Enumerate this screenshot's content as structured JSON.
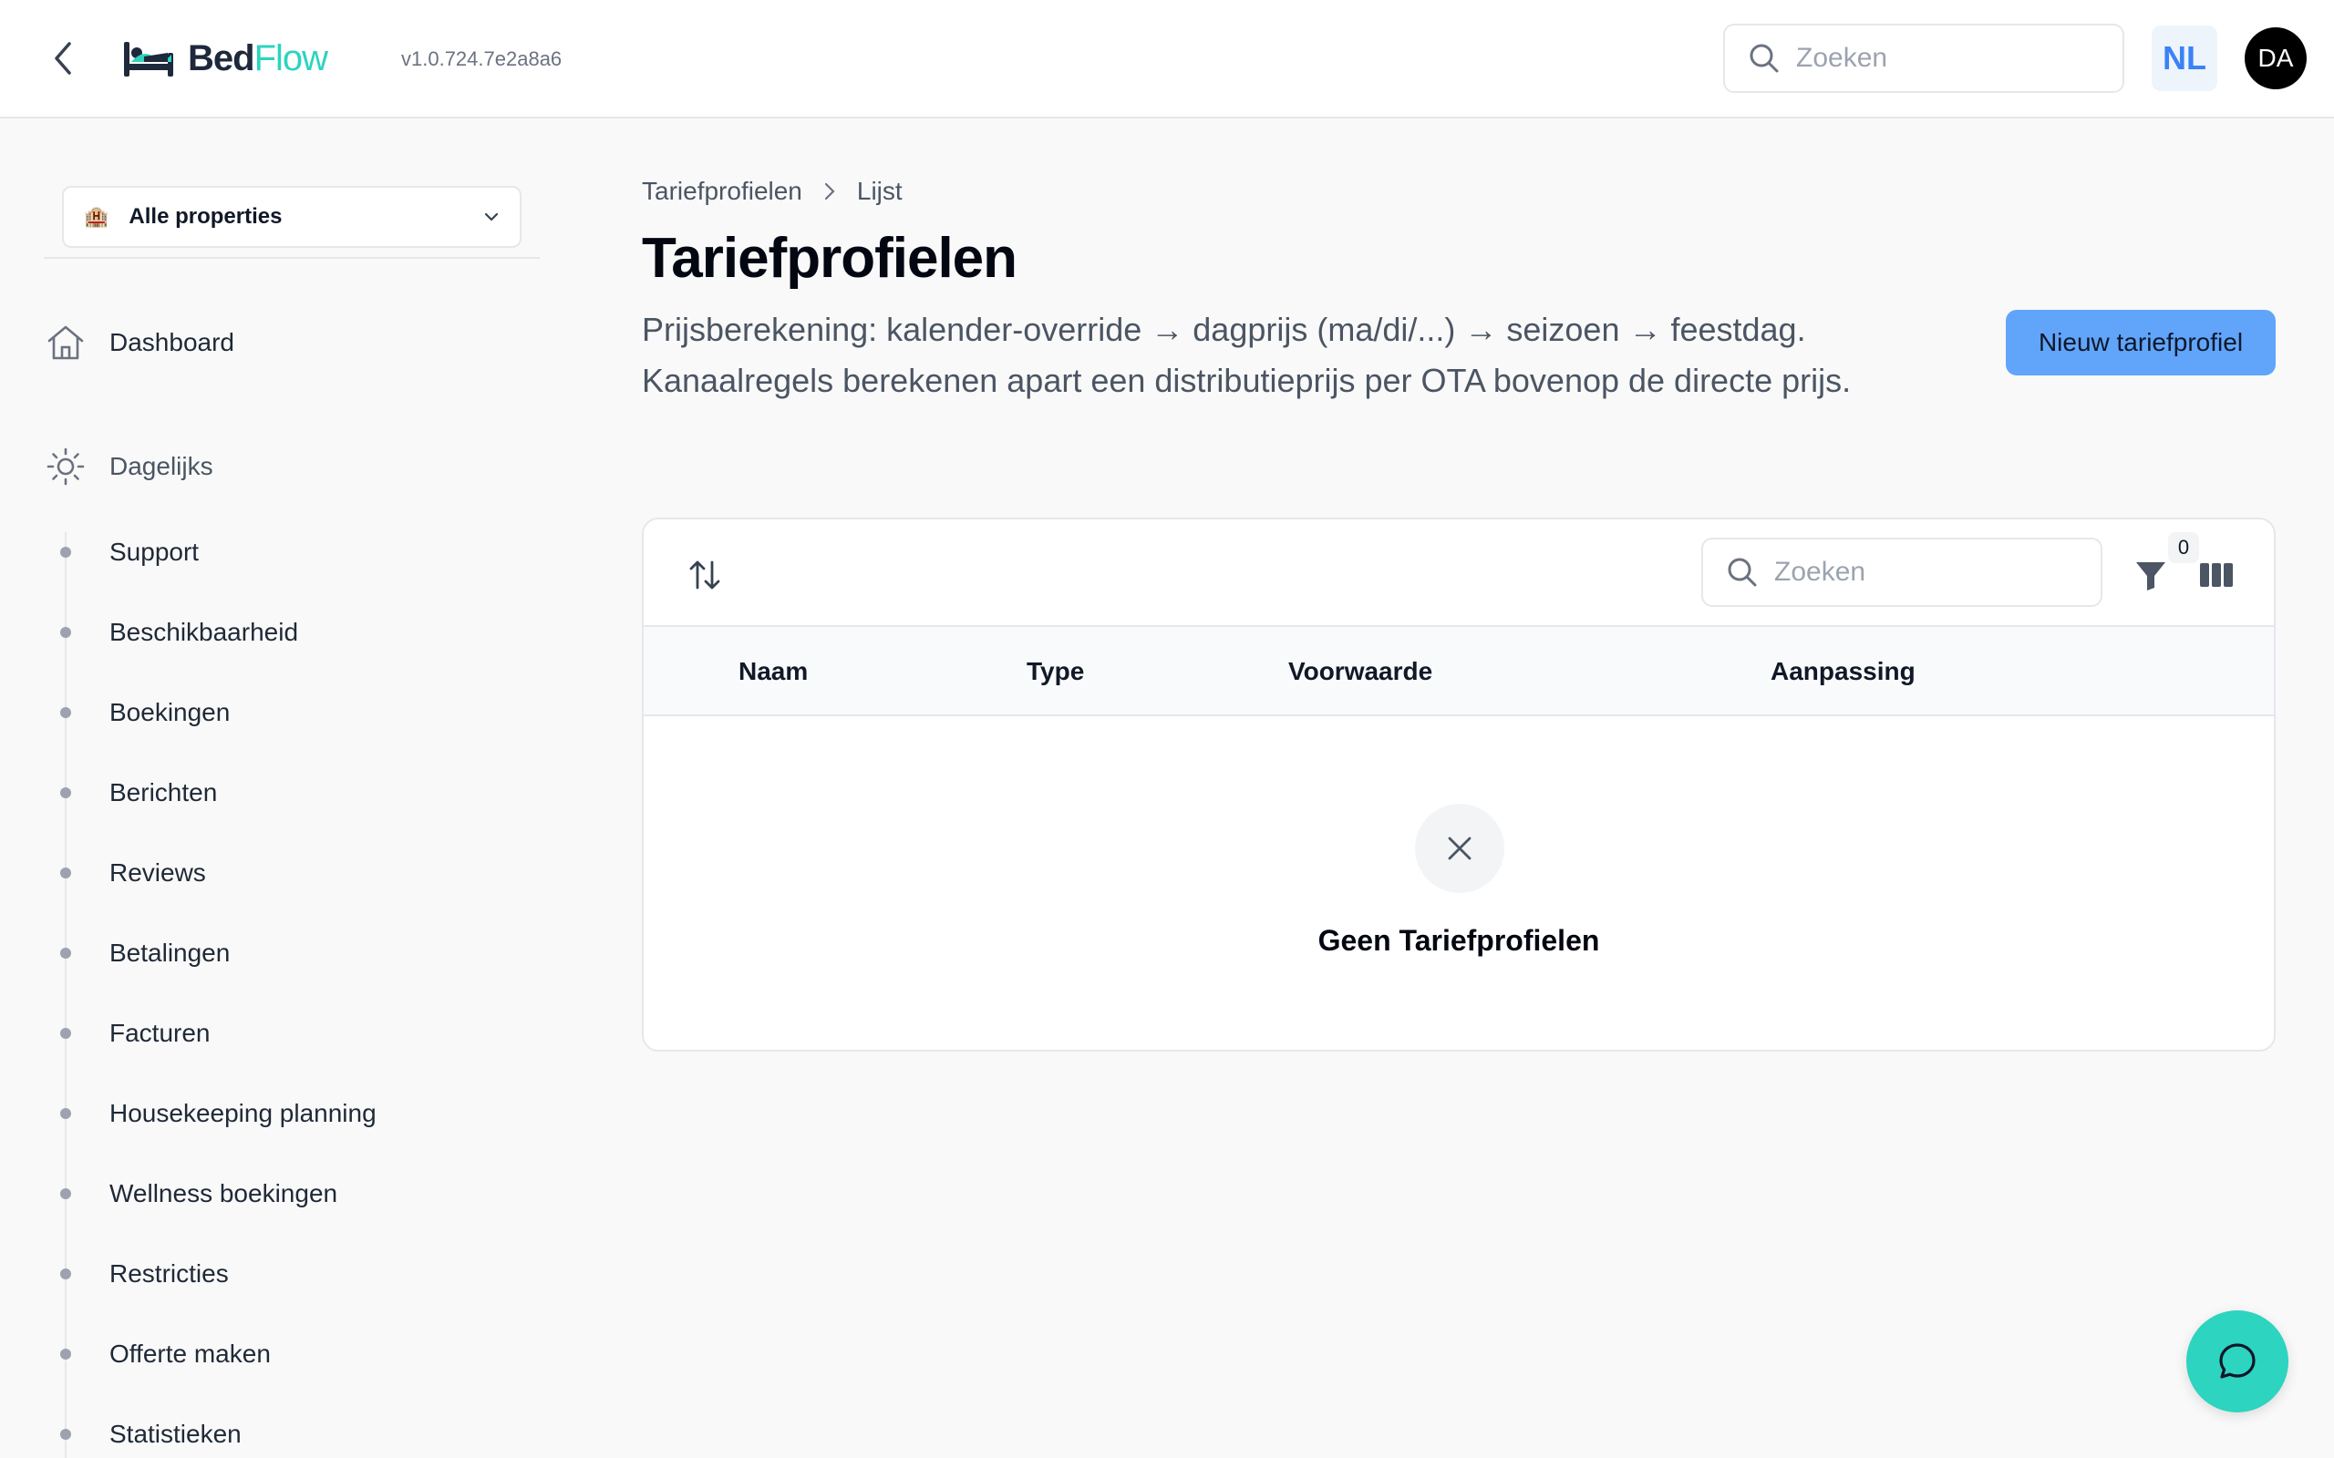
{
  "app": {
    "logo_bed": "Bed",
    "logo_flow": "Flow",
    "version": "v1.0.724.7e2a8a6"
  },
  "header": {
    "search_placeholder": "Zoeken",
    "language": "NL",
    "user_initials": "DA"
  },
  "sidebar": {
    "property_select": "Alle properties",
    "dashboard": "Dashboard",
    "section_daily": "Dagelijks",
    "items": [
      {
        "label": "Support"
      },
      {
        "label": "Beschikbaarheid"
      },
      {
        "label": "Boekingen"
      },
      {
        "label": "Berichten"
      },
      {
        "label": "Reviews"
      },
      {
        "label": "Betalingen"
      },
      {
        "label": "Facturen"
      },
      {
        "label": "Housekeeping planning"
      },
      {
        "label": "Wellness boekingen"
      },
      {
        "label": "Restricties"
      },
      {
        "label": "Offerte maken"
      },
      {
        "label": "Statistieken"
      }
    ]
  },
  "main": {
    "breadcrumb": [
      "Tariefprofielen",
      "Lijst"
    ],
    "title": "Tariefprofielen",
    "description": "Prijsberekening: kalender-override → dagprijs (ma/di/...) → seizoen → feestdag. Kanaalregels berekenen apart een distributieprijs per OTA bovenop de directe prijs.",
    "new_button": "Nieuw tariefprofiel"
  },
  "table": {
    "search_placeholder": "Zoeken",
    "filter_count": "0",
    "columns": [
      "Naam",
      "Type",
      "Voorwaarde",
      "Aanpassing"
    ],
    "empty_message": "Geen Tariefprofielen"
  },
  "colors": {
    "accent": "#2dd4bf",
    "primary_button": "#60a5fa",
    "lang_badge_text": "#3b82f6"
  }
}
